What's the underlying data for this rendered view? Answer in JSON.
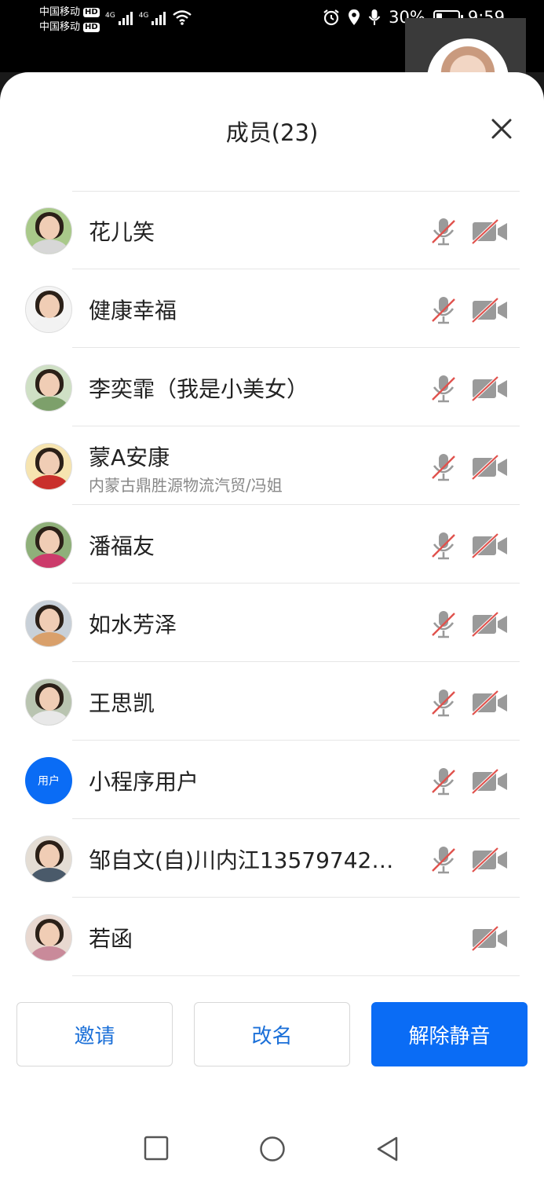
{
  "status_bar": {
    "carrier1": "中国移动",
    "carrier2": "中国移动",
    "hd_label": "HD",
    "network1": "4G",
    "network2": "4G",
    "battery_percent": "30%",
    "battery_level": 0.3,
    "time": "9:59",
    "icons": [
      "alarm-icon",
      "location-icon",
      "microphone-icon",
      "wifi-icon"
    ]
  },
  "sheet": {
    "title": "成员(23)",
    "close_icon": "close-icon"
  },
  "members": [
    {
      "name": "花儿笑",
      "subtitle": "",
      "avatar": "photo",
      "mic": true
    },
    {
      "name": "健康幸福",
      "subtitle": "",
      "avatar": "photo",
      "mic": true
    },
    {
      "name": "李奕霏（我是小美女）",
      "subtitle": "",
      "avatar": "photo",
      "mic": true
    },
    {
      "name": "蒙A安康",
      "subtitle": "内蒙古鼎胜源物流汽贸/冯姐",
      "avatar": "photo",
      "mic": true
    },
    {
      "name": "潘福友",
      "subtitle": "",
      "avatar": "photo",
      "mic": true
    },
    {
      "name": "如水芳泽",
      "subtitle": "",
      "avatar": "photo",
      "mic": true
    },
    {
      "name": "王思凯",
      "subtitle": "",
      "avatar": "photo",
      "mic": true
    },
    {
      "name": "小程序用户",
      "subtitle": "",
      "avatar": "text",
      "avatar_text": "用户",
      "mic": true
    },
    {
      "name": "邹自文(自)川内江13579742…",
      "subtitle": "",
      "avatar": "photo",
      "mic": true
    },
    {
      "name": "若函",
      "subtitle": "",
      "avatar": "photo",
      "mic": false
    }
  ],
  "buttons": {
    "invite": "邀请",
    "rename": "改名",
    "unmute": "解除静音"
  },
  "colors": {
    "accent": "#0a6cf5",
    "muted_slash": "#e0524d",
    "icon_gray": "#9a9a9a"
  },
  "navigation": [
    "recent-apps-button",
    "home-button",
    "back-button"
  ]
}
